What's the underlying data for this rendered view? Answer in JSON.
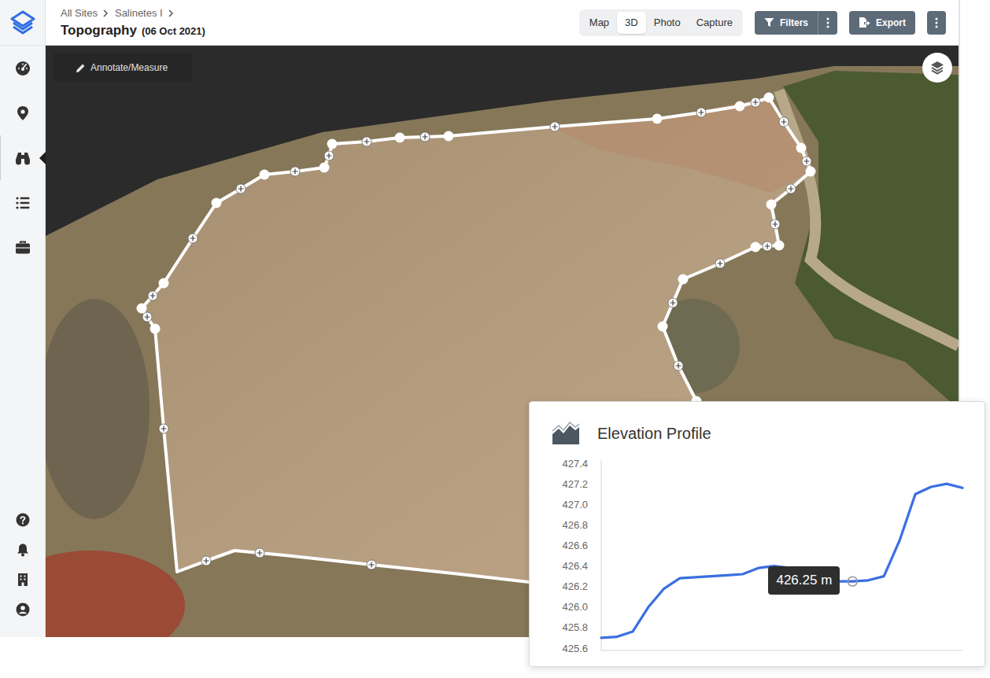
{
  "sidebar": {
    "top_items": [
      {
        "kind": "dashboard",
        "selected": false
      },
      {
        "kind": "location",
        "selected": false
      },
      {
        "kind": "explore",
        "selected": true
      },
      {
        "kind": "list",
        "selected": false
      },
      {
        "kind": "briefcase",
        "selected": false
      }
    ],
    "bottom_items": [
      {
        "kind": "help",
        "selected": false
      },
      {
        "kind": "notifications",
        "selected": false
      },
      {
        "kind": "organization",
        "selected": false
      },
      {
        "kind": "account",
        "selected": false
      }
    ]
  },
  "breadcrumbs": [
    "All Sites",
    "Salinetes I"
  ],
  "page": {
    "title": "Topography",
    "date": "(06 Oct 2021)"
  },
  "view_tabs": [
    {
      "label": "Map",
      "selected": false
    },
    {
      "label": "3D",
      "selected": true
    },
    {
      "label": "Photo",
      "selected": false
    },
    {
      "label": "Capture",
      "selected": false
    }
  ],
  "toolbar": {
    "filters": "Filters",
    "export": "Export"
  },
  "viewer": {
    "annotate_button": "Annotate/Measure"
  },
  "elevation_profile": {
    "title": "Elevation Profile",
    "y_ticks": [
      "427.4",
      "427.2",
      "427.0",
      "426.8",
      "426.6",
      "426.4",
      "426.2",
      "426.0",
      "425.8",
      "425.6"
    ],
    "series": [
      {
        "values": [
          425.7,
          425.71,
          425.76,
          426.0,
          426.18,
          426.28,
          426.29,
          426.3,
          426.31,
          426.32,
          426.38,
          426.4,
          426.38,
          426.3,
          426.26,
          426.25,
          426.25,
          426.26,
          426.3,
          426.65,
          427.1,
          427.17,
          427.2,
          427.16
        ]
      }
    ],
    "tooltip": {
      "text": "426.25 m",
      "index": 16
    }
  }
}
